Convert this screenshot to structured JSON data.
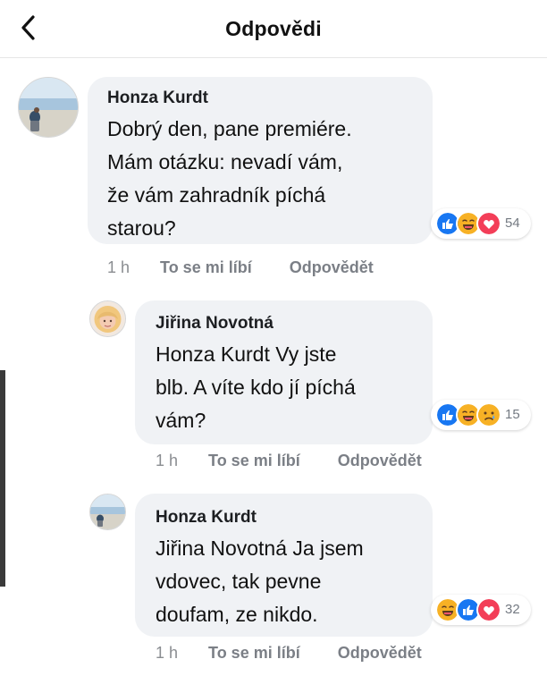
{
  "header": {
    "title": "Odpovědi"
  },
  "comments": [
    {
      "author": "Honza Kurdt",
      "lines": [
        "Dobrý den, pane premiére.",
        "Mám otázku: nevadí vám,",
        "že vám zahradník píchá",
        "starou?"
      ],
      "reactions": [
        "like",
        "haha",
        "love"
      ],
      "reaction_count": "54",
      "time": "1 h",
      "like_label": "To se mi líbí",
      "reply_label": "Odpovědět"
    },
    {
      "author": "Jiřina Novotná",
      "lines": [
        "Honza Kurdt Vy jste",
        "blb. A víte kdo jí píchá",
        "vám?"
      ],
      "reactions": [
        "like",
        "haha",
        "sad"
      ],
      "reaction_count": "15",
      "time": "1 h",
      "like_label": "To se mi líbí",
      "reply_label": "Odpovědět"
    },
    {
      "author": "Honza Kurdt",
      "lines": [
        "Jiřina Novotná Ja jsem",
        "vdovec, tak pevne",
        "doufam, ze nikdo."
      ],
      "reactions": [
        "haha",
        "like",
        "love"
      ],
      "reaction_count": "32",
      "time": "1 h",
      "like_label": "To se mi líbí",
      "reply_label": "Odpovědět"
    }
  ],
  "colors": {
    "bubble": "#f0f2f5",
    "like": "#1877f2",
    "love": "#f33e58",
    "haha": "#f7b125",
    "meta_text": "#7b7f86"
  }
}
